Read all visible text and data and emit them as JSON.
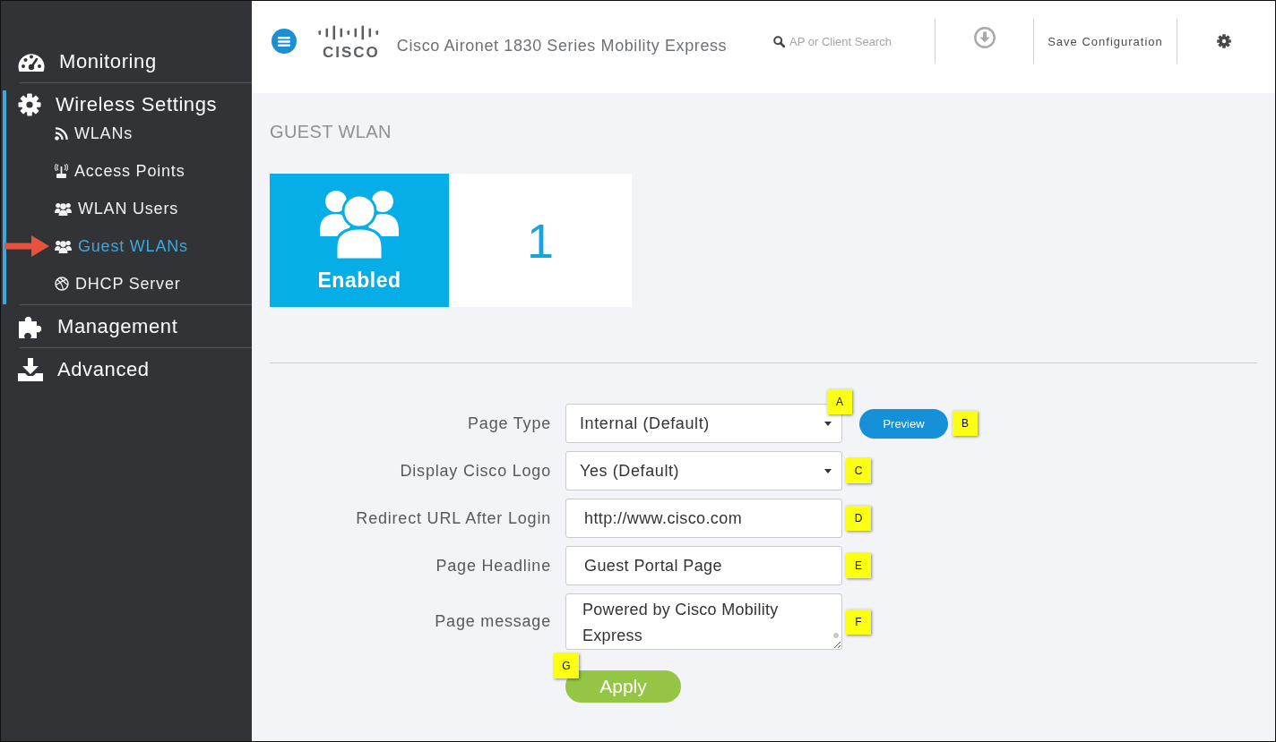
{
  "sidebar": {
    "items": [
      {
        "label": "Monitoring",
        "expanded": false
      },
      {
        "label": "Wireless Settings",
        "expanded": true,
        "children": [
          {
            "label": "WLANs",
            "selected": false
          },
          {
            "label": "Access Points",
            "selected": false
          },
          {
            "label": "WLAN Users",
            "selected": false
          },
          {
            "label": "Guest WLANs",
            "selected": true
          },
          {
            "label": "DHCP Server",
            "selected": false
          }
        ]
      },
      {
        "label": "Management",
        "expanded": false
      },
      {
        "label": "Advanced",
        "expanded": false
      }
    ]
  },
  "header": {
    "logo_text": "CISCO",
    "title": "Cisco Aironet 1830 Series Mobility Express",
    "search": {
      "placeholder": "AP or Client Search"
    },
    "save_button": "Save Configuration"
  },
  "page": {
    "title": "GUEST WLAN",
    "status_card": {
      "label": "Enabled",
      "count": "1"
    },
    "form": {
      "fields": [
        {
          "label": "Page Type",
          "kind": "select",
          "value": "Internal (Default)",
          "callout": "A",
          "button": {
            "label": "Preview",
            "callout": "B"
          }
        },
        {
          "label": "Display Cisco Logo",
          "kind": "select",
          "value": "Yes (Default)",
          "callout": "C"
        },
        {
          "label": "Redirect URL After Login",
          "kind": "text",
          "value": "http://www.cisco.com",
          "callout": "D"
        },
        {
          "label": "Page Headline",
          "kind": "text",
          "value": "Guest Portal Page",
          "callout": "E"
        },
        {
          "label": "Page message",
          "kind": "textarea",
          "value": "Powered by Cisco Mobility Express",
          "callout": "F"
        }
      ],
      "apply_button": {
        "label": "Apply",
        "callout": "G"
      }
    }
  }
}
